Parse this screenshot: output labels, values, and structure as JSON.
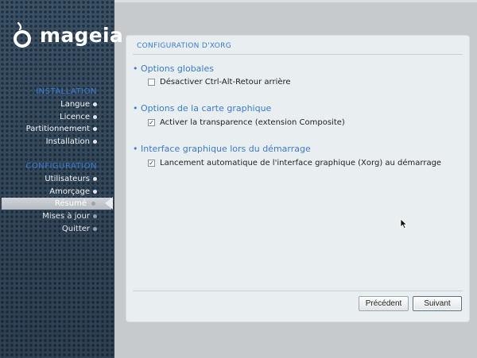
{
  "app": {
    "logo_text": "mageia"
  },
  "sidebar": {
    "installation_head": "INSTALLATION",
    "configuration_head": "CONFIGURATION",
    "installation_items": [
      {
        "label": "Langue"
      },
      {
        "label": "Licence"
      },
      {
        "label": "Partitionnement"
      },
      {
        "label": "Installation"
      }
    ],
    "configuration_items": [
      {
        "label": "Utilisateurs"
      },
      {
        "label": "Amorçage"
      },
      {
        "label": "Résumé",
        "active": true
      },
      {
        "label": "Mises à jour"
      },
      {
        "label": "Quitter"
      }
    ]
  },
  "panel": {
    "title": "CONFIGURATION D'XORG",
    "groups": [
      {
        "title": "• Options globales",
        "option": {
          "label": "Désactiver Ctrl-Alt-Retour arrière",
          "checked": false
        }
      },
      {
        "title": "• Options de la carte graphique",
        "option": {
          "label": "Activer la transparence (extension Composite)",
          "checked": true
        }
      },
      {
        "title": "• Interface graphique lors du démarrage",
        "option": {
          "label": "Lancement automatique de l'interface graphique (Xorg) au démarrage",
          "checked": true
        }
      }
    ]
  },
  "buttons": {
    "previous": "Précédent",
    "next": "Suivant"
  },
  "colors": {
    "accent": "#3a7bd5",
    "sidebar": "#33475a",
    "panel": "#e9eef1"
  }
}
